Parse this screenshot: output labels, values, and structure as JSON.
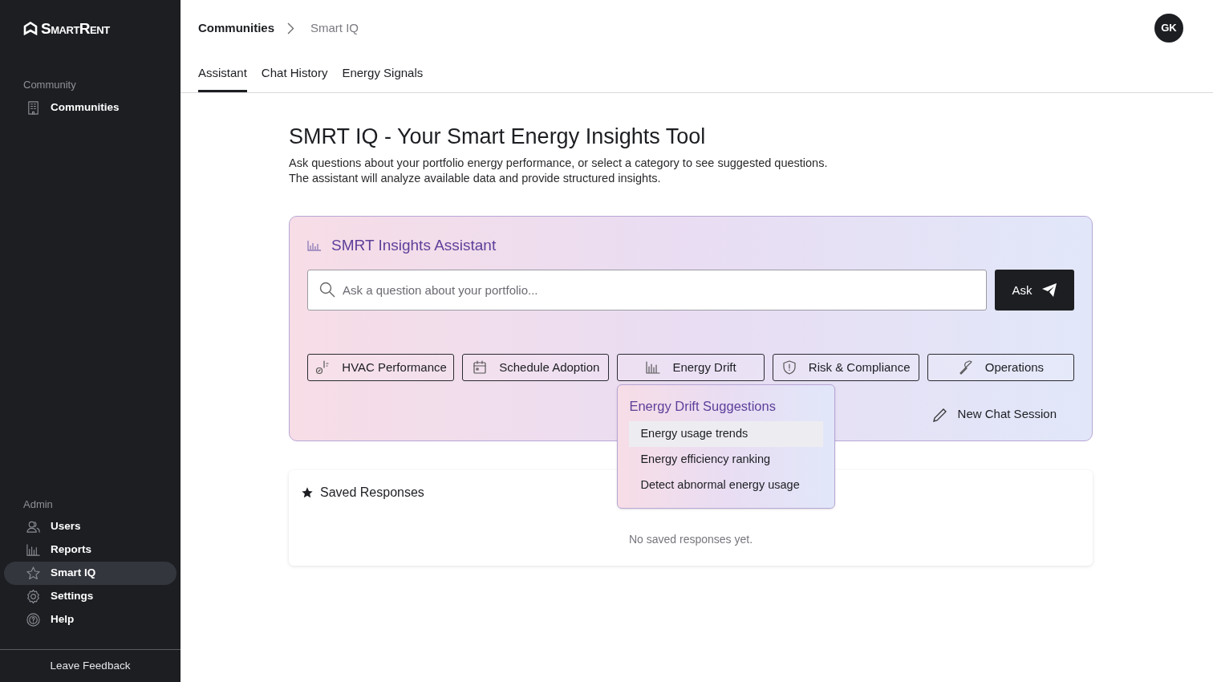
{
  "sidebar": {
    "logo": "SmartRent",
    "sections": [
      {
        "heading": "Community",
        "items": [
          {
            "label": "Communities",
            "selected": false
          }
        ]
      },
      {
        "heading": "Admin",
        "items": [
          {
            "label": "Users",
            "selected": false
          },
          {
            "label": "Reports",
            "selected": false
          },
          {
            "label": "Smart IQ",
            "selected": true
          },
          {
            "label": "Settings",
            "selected": false
          },
          {
            "label": "Help",
            "selected": false
          }
        ]
      }
    ],
    "footer": "Leave Feedback"
  },
  "breadcrumb": [
    "Communities",
    "Smart IQ"
  ],
  "avatar": "GK",
  "tabs": [
    {
      "label": "Assistant",
      "selected": true
    },
    {
      "label": "Chat History",
      "selected": false
    },
    {
      "label": "Energy Signals",
      "selected": false
    }
  ],
  "page": {
    "title": "SMRT IQ - Your Smart Energy Insights Tool",
    "description": [
      "Ask questions about your portfolio energy performance, or select a category to see suggested questions.",
      "The assistant will analyze available data and provide structured insights."
    ]
  },
  "assistant": {
    "title": "SMRT Insights Assistant",
    "search": {
      "placeholder": "Ask a question about your portfolio..."
    },
    "ask_button": "Ask",
    "categories": [
      {
        "label": "HVAC Performance"
      },
      {
        "label": "Schedule Adoption"
      },
      {
        "label": "Energy Drift",
        "menu": {
          "title": "Energy Drift Suggestions",
          "items": [
            {
              "label": "Energy usage trends",
              "highlighted": true
            },
            {
              "label": "Energy efficiency ranking",
              "highlighted": false
            },
            {
              "label": "Detect abnormal energy usage",
              "highlighted": false
            }
          ]
        }
      },
      {
        "label": "Risk & Compliance"
      },
      {
        "label": "Operations"
      }
    ],
    "new_chat": "New Chat Session"
  },
  "saved": {
    "title": "Saved Responses",
    "empty": "No saved responses yet."
  }
}
